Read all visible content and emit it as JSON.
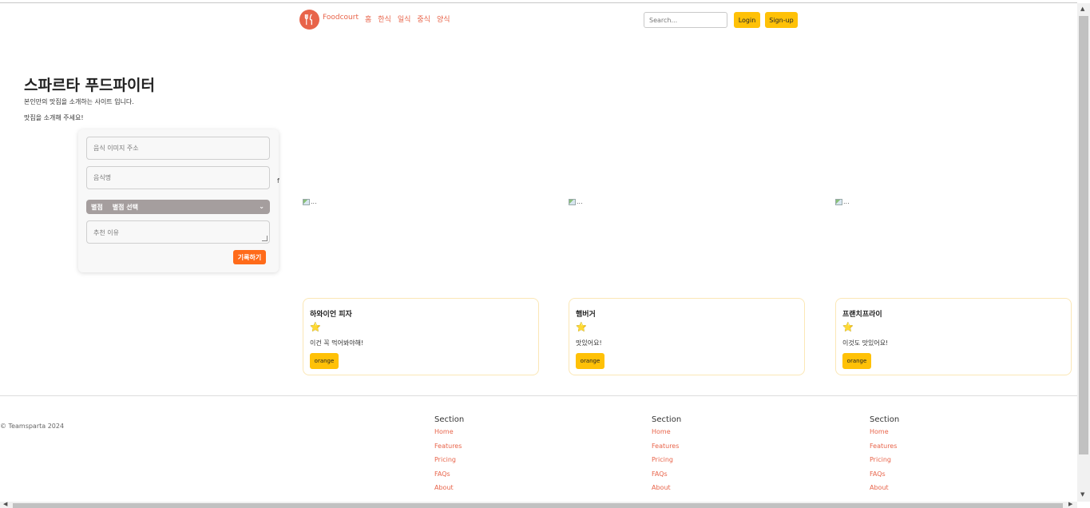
{
  "header": {
    "brand": "Foodcourt",
    "nav": [
      "홈",
      "한식",
      "일식",
      "중식",
      "양식"
    ],
    "search_placeholder": "Search...",
    "login_label": "Login",
    "signup_label": "Sign-up"
  },
  "hero": {
    "title": "스파르타 푸드파이터",
    "subtitle1": "본인만의 맛집을 소개하는 사이트 입니다.",
    "subtitle2": "맛집을 소개해 주세요!"
  },
  "form": {
    "image_placeholder": "음식 이미지 주소",
    "name_placeholder": "음식명",
    "select_label": "별점",
    "select_value": "별점 선택",
    "reason_placeholder": "추천 이유",
    "submit_label": "기록하기",
    "stray_char": "f"
  },
  "images": [
    {
      "alt": "..."
    },
    {
      "alt": "..."
    },
    {
      "alt": "..."
    }
  ],
  "cards": [
    {
      "title": "하와이언 피자",
      "stars": "⭐",
      "comment": "이건 꼭 먹어봐야해!",
      "button": "orange"
    },
    {
      "title": "햄버거",
      "stars": "⭐",
      "comment": "맛있어요!",
      "button": "orange"
    },
    {
      "title": "프랜치프라이",
      "stars": "⭐",
      "comment": "이것도 맛있어요!",
      "button": "orange"
    }
  ],
  "footer": {
    "copyright": "© Teamsparta 2024",
    "columns": [
      {
        "heading": "Section",
        "links": [
          "Home",
          "Features",
          "Pricing",
          "FAQs",
          "About"
        ]
      },
      {
        "heading": "Section",
        "links": [
          "Home",
          "Features",
          "Pricing",
          "FAQs",
          "About"
        ]
      },
      {
        "heading": "Section",
        "links": [
          "Home",
          "Features",
          "Pricing",
          "FAQs",
          "About"
        ]
      }
    ]
  },
  "colors": {
    "accent": "#e8644a",
    "button_yellow": "#ffc107",
    "submit_orange": "#ff6b1a",
    "select_bg": "#a59e9e"
  },
  "icons": {
    "logo": "fork-knife-icon",
    "select_chevron": "chevron-down-icon",
    "broken_image": "broken-image-icon"
  }
}
